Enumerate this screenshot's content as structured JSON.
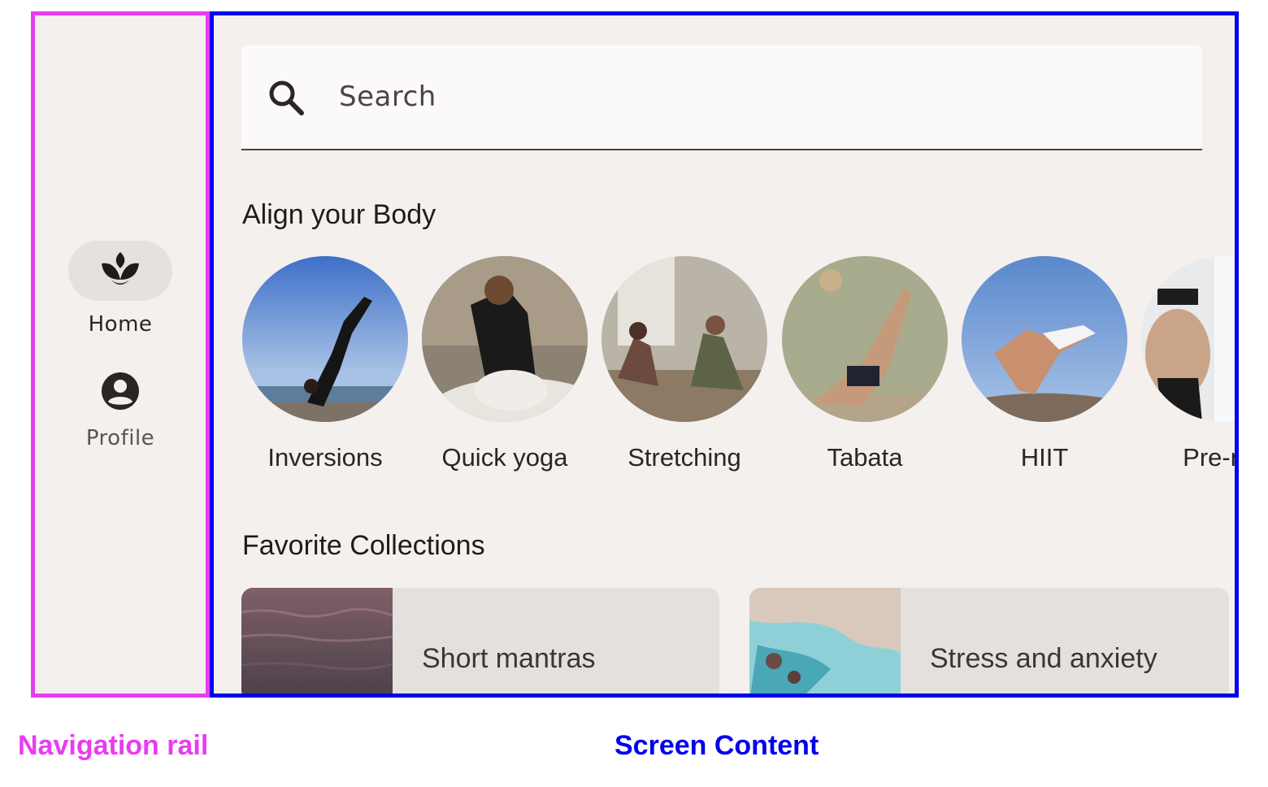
{
  "nav_rail": {
    "items": [
      {
        "label": "Home",
        "icon": "spa-icon",
        "selected": true
      },
      {
        "label": "Profile",
        "icon": "account-circle-icon",
        "selected": false
      }
    ]
  },
  "search": {
    "placeholder": "Search",
    "icon": "search-icon"
  },
  "align_section": {
    "title": "Align your Body",
    "items": [
      {
        "label": "Inversions"
      },
      {
        "label": "Quick yoga"
      },
      {
        "label": "Stretching"
      },
      {
        "label": "Tabata"
      },
      {
        "label": "HIIT"
      },
      {
        "label": "Pre-nat"
      }
    ]
  },
  "favorites_section": {
    "title": "Favorite Collections",
    "items": [
      {
        "label": "Short mantras"
      },
      {
        "label": "Stress and anxiety"
      }
    ]
  },
  "annotations": {
    "rail_caption": "Navigation rail",
    "content_caption": "Screen Content",
    "rail_color": "#e83cf0",
    "content_color": "#0000ee"
  },
  "colors": {
    "background": "#f3f0ee",
    "nav_indicator": "#e6e1de",
    "search_field": "#fbf9fa",
    "card": "#e4e0dd"
  }
}
